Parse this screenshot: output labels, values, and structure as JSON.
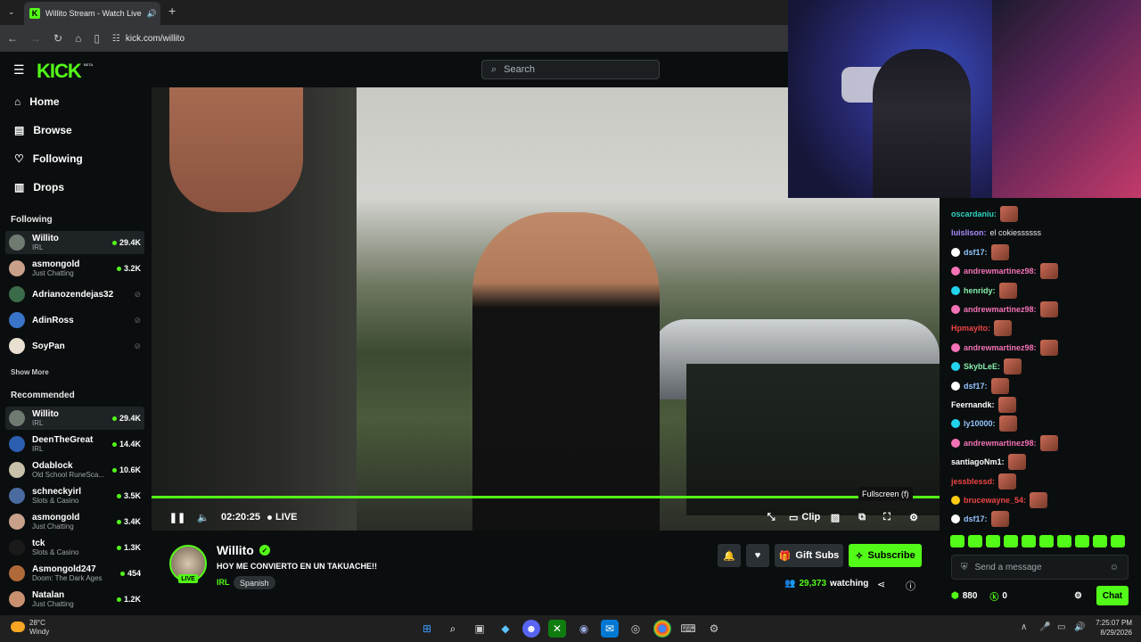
{
  "browser": {
    "tab_title": "Willito Stream - Watch Live",
    "url": "kick.com/willito"
  },
  "header": {
    "logo": "KICK",
    "beta": "BETA",
    "search_placeholder": "Search"
  },
  "sidebar": {
    "nav": [
      {
        "label": "Home",
        "icon": "home-icon"
      },
      {
        "label": "Browse",
        "icon": "browse-icon"
      },
      {
        "label": "Following",
        "icon": "heart-icon"
      },
      {
        "label": "Drops",
        "icon": "drops-icon"
      }
    ],
    "following_title": "Following",
    "following": [
      {
        "name": "Willito",
        "category": "IRL",
        "viewers": "29.4K",
        "color": "#6f7a70"
      },
      {
        "name": "asmongold",
        "category": "Just Chatting",
        "viewers": "3.2K",
        "color": "#c9a08a"
      },
      {
        "name": "Adrianozendejas32",
        "category": "",
        "viewers": "",
        "color": "#3a6b4a"
      },
      {
        "name": "AdinRoss",
        "category": "",
        "viewers": "",
        "color": "#3a74c9"
      },
      {
        "name": "SoyPan",
        "category": "",
        "viewers": "",
        "color": "#e8e0d0"
      }
    ],
    "show_more": "Show More",
    "recommended_title": "Recommended",
    "recommended": [
      {
        "name": "Willito",
        "category": "IRL",
        "viewers": "29.4K",
        "color": "#6f7a70"
      },
      {
        "name": "DeenTheGreat",
        "category": "IRL",
        "viewers": "14.4K",
        "color": "#2d5fb0"
      },
      {
        "name": "Odablock",
        "category": "Old School RuneSca...",
        "viewers": "10.6K",
        "color": "#c8c0a8"
      },
      {
        "name": "schneckyirl",
        "category": "Slots & Casino",
        "viewers": "3.5K",
        "color": "#4a6aa0"
      },
      {
        "name": "asmongold",
        "category": "Just Chatting",
        "viewers": "3.4K",
        "color": "#c9a08a"
      },
      {
        "name": "tck",
        "category": "Slots & Casino",
        "viewers": "1.3K",
        "color": "#1a1a1a"
      },
      {
        "name": "Asmongold247",
        "category": "Doom: The Dark Ages",
        "viewers": "454",
        "color": "#b06a3a"
      },
      {
        "name": "Natalan",
        "category": "Just Chatting",
        "viewers": "1.2K",
        "color": "#c99070"
      }
    ]
  },
  "player": {
    "time": "02:20:25",
    "live_label": "LIVE",
    "clip_label": "Clip",
    "tooltip": "Fullscreen (f)"
  },
  "stream": {
    "name": "Willito",
    "live_badge": "LIVE",
    "title": "HOY ME CONVIERTO EN UN TAKUACHE!!",
    "category": "IRL",
    "language": "Spanish",
    "viewers": "29,373",
    "watching_label": "watching",
    "gift_subs": "Gift Subs",
    "subscribe": "Subscribe"
  },
  "chat": {
    "messages": [
      {
        "user": "oscardaniu:",
        "text": "",
        "color": "#2dd4bf"
      },
      {
        "user": "luislison:",
        "text": "el cokiessssss",
        "color": "#a78bfa"
      },
      {
        "user": "dsf17:",
        "text": "",
        "color": "#93c5fd"
      },
      {
        "user": "andrewmartinez98:",
        "text": "",
        "color": "#f472b6"
      },
      {
        "user": "henridy:",
        "text": "",
        "color": "#86efac"
      },
      {
        "user": "andrewmartinez98:",
        "text": "",
        "color": "#f472b6"
      },
      {
        "user": "Hpmayito:",
        "text": "",
        "color": "#ef4444"
      },
      {
        "user": "andrewmartinez98:",
        "text": "",
        "color": "#f472b6"
      },
      {
        "user": "SkybLeE:",
        "text": "",
        "color": "#86efac"
      },
      {
        "user": "dsf17:",
        "text": "",
        "color": "#93c5fd"
      },
      {
        "user": "Feernandk:",
        "text": "",
        "color": "#ffffff"
      },
      {
        "user": "ly10000:",
        "text": "",
        "color": "#93c5fd"
      },
      {
        "user": "andrewmartinez98:",
        "text": "",
        "color": "#f472b6"
      },
      {
        "user": "santiagoNm1:",
        "text": "",
        "color": "#ffffff"
      },
      {
        "user": "jessblessd:",
        "text": "",
        "color": "#ef4444"
      },
      {
        "user": "brucewayne_54:",
        "text": "",
        "color": "#ef4444"
      },
      {
        "user": "dsf17:",
        "text": "",
        "color": "#93c5fd"
      }
    ],
    "input_placeholder": "Send a message",
    "points": "880",
    "kicks": "0",
    "chat_button": "Chat"
  },
  "taskbar": {
    "temperature": "28°C",
    "weather": "Windy",
    "time": "7:25:07 PM",
    "date": "8/29/2026"
  },
  "colors": {
    "accent": "#53fc18",
    "background": "#0b0e0f"
  }
}
